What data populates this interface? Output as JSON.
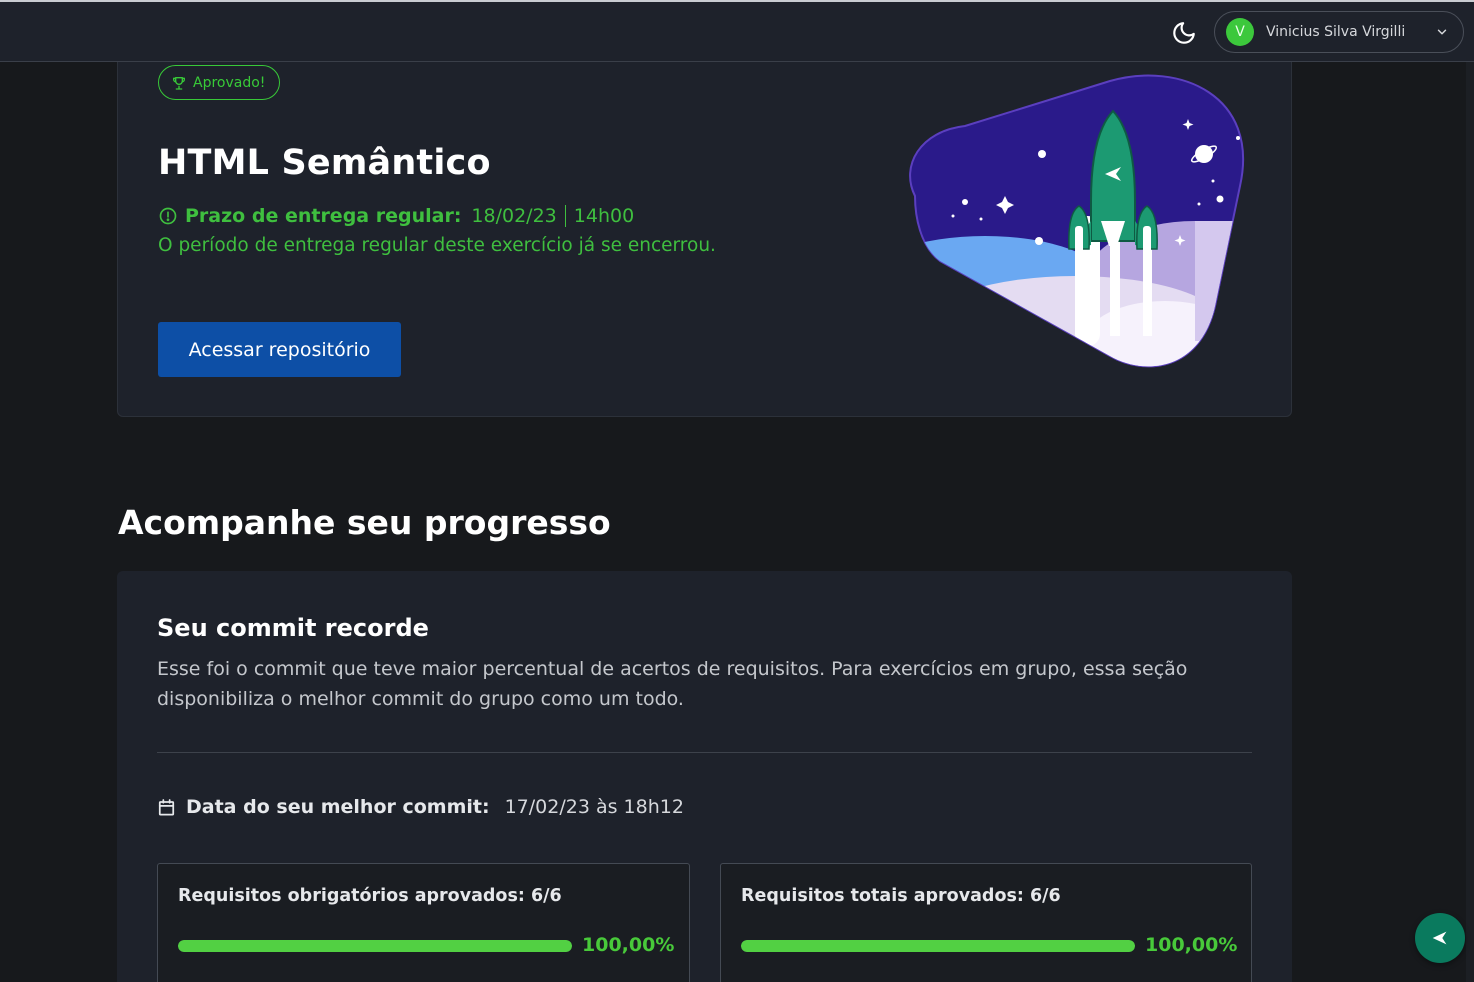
{
  "topbar": {
    "user": {
      "initial": "V",
      "name": "Vinicius Silva Virgilli"
    }
  },
  "exercise": {
    "badge": "Aprovado!",
    "title": "HTML Semântico",
    "deadline_label": "Prazo de entrega regular:",
    "deadline_date": "18/02/23",
    "deadline_time": "14h00",
    "closed_message": "O período de entrega regular deste exercício já se encerrou.",
    "repo_button": "Acessar repositório"
  },
  "progress": {
    "section_title": "Acompanhe seu progresso",
    "card_title": "Seu commit recorde",
    "description": "Esse foi o commit que teve maior percentual de acertos de requisitos. Para exercícios em grupo, essa seção disponibiliza o melhor commit do grupo como um todo.",
    "best_commit_label": "Data do seu melhor commit:",
    "best_commit_value": "17/02/23 às 18h12",
    "requirements": [
      {
        "title": "Requisitos obrigatórios aprovados: 6/6",
        "percent_label": "100,00%",
        "fraction": 1.0
      },
      {
        "title": "Requisitos totais aprovados: 6/6",
        "percent_label": "100,00%",
        "fraction": 1.0
      }
    ]
  },
  "colors": {
    "success": "#3fbf3f",
    "primary_button": "#0d4fa6",
    "card": "#1e222b",
    "background": "#17191c",
    "progress_fill": "#52d043"
  },
  "icons": [
    "moon-icon",
    "chevron-down-icon",
    "trophy-icon",
    "alert-circle-icon",
    "calendar-icon",
    "rocket-logo-icon"
  ]
}
